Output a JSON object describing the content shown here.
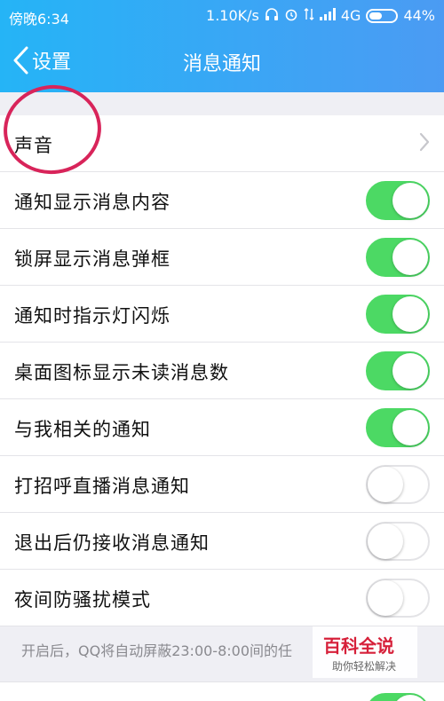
{
  "status": {
    "time": "傍晚6:34",
    "speed": "1.10K/s",
    "network": "4G",
    "battery": "44%"
  },
  "nav": {
    "back_label": "设置",
    "title": "消息通知"
  },
  "rows": [
    {
      "label": "声音",
      "type": "link"
    },
    {
      "label": "通知显示消息内容",
      "type": "switch",
      "on": true
    },
    {
      "label": "锁屏显示消息弹框",
      "type": "switch",
      "on": true
    },
    {
      "label": "通知时指示灯闪烁",
      "type": "switch",
      "on": true
    },
    {
      "label": "桌面图标显示未读消息数",
      "type": "switch",
      "on": true
    },
    {
      "label": "与我相关的通知",
      "type": "switch",
      "on": true
    },
    {
      "label": "打招呼直播消息通知",
      "type": "switch",
      "on": false
    },
    {
      "label": "退出后仍接收消息通知",
      "type": "switch",
      "on": false
    },
    {
      "label": "夜间防骚扰模式",
      "type": "switch",
      "on": false
    }
  ],
  "footnote": "开启后，QQ将自动屏蔽23:00-8:00间的任",
  "watermark": {
    "title": "百科全说",
    "subtitle": "助你轻松解决"
  },
  "colors": {
    "header_start": "#25b4f6",
    "header_end": "#4b9bf3",
    "switch_on": "#4cd964",
    "annotation": "#d8245a"
  }
}
